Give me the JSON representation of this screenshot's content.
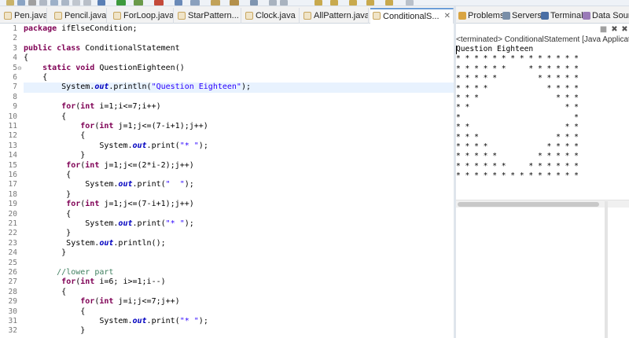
{
  "editor_tabs": [
    {
      "label": "Pen.java",
      "active": false
    },
    {
      "label": "Pencil.java",
      "active": false
    },
    {
      "label": "ForLoop.java",
      "active": false
    },
    {
      "label": "StarPattern...",
      "active": false
    },
    {
      "label": "Clock.java",
      "active": false
    },
    {
      "label": "AllPattern.java",
      "active": false
    },
    {
      "label": "ConditionalS...",
      "active": true
    }
  ],
  "active_tab_close": "✕",
  "line_numbers": [
    "1",
    "2",
    "3",
    "4",
    "5",
    "6",
    "7",
    "8",
    "9",
    "10",
    "11",
    "12",
    "13",
    "14",
    "15",
    "16",
    "17",
    "18",
    "19",
    "20",
    "21",
    "22",
    "23",
    "24",
    "25",
    "26",
    "27",
    "28",
    "29",
    "30",
    "31",
    "32"
  ],
  "fold_markers": {
    "line_5": "⊖"
  },
  "code_lines": [
    [
      {
        "t": "package",
        "c": "kw"
      },
      {
        "t": " ifElseCondition;",
        "c": ""
      }
    ],
    [],
    [
      {
        "t": "public",
        "c": "kw"
      },
      {
        "t": " ",
        "c": ""
      },
      {
        "t": "class",
        "c": "kw"
      },
      {
        "t": " ConditionalStatement",
        "c": ""
      }
    ],
    [
      {
        "t": "{",
        "c": ""
      }
    ],
    [
      {
        "t": "    ",
        "c": ""
      },
      {
        "t": "static",
        "c": "kw"
      },
      {
        "t": " ",
        "c": ""
      },
      {
        "t": "void",
        "c": "kw"
      },
      {
        "t": " QuestionEighteen()",
        "c": ""
      }
    ],
    [
      {
        "t": "    {",
        "c": ""
      }
    ],
    [
      {
        "t": "        System.",
        "c": ""
      },
      {
        "t": "out",
        "c": "fld"
      },
      {
        "t": ".println(",
        "c": ""
      },
      {
        "t": "\"Question Eighteen\"",
        "c": "str"
      },
      {
        "t": ");",
        "c": ""
      }
    ],
    [],
    [
      {
        "t": "        ",
        "c": ""
      },
      {
        "t": "for",
        "c": "kw"
      },
      {
        "t": "(",
        "c": ""
      },
      {
        "t": "int",
        "c": "kw"
      },
      {
        "t": " i=1;i<=7;i++)",
        "c": ""
      }
    ],
    [
      {
        "t": "        {",
        "c": ""
      }
    ],
    [
      {
        "t": "            ",
        "c": ""
      },
      {
        "t": "for",
        "c": "kw"
      },
      {
        "t": "(",
        "c": ""
      },
      {
        "t": "int",
        "c": "kw"
      },
      {
        "t": " j=1;j<=(7-i+1);j++)",
        "c": ""
      }
    ],
    [
      {
        "t": "            {",
        "c": ""
      }
    ],
    [
      {
        "t": "                System.",
        "c": ""
      },
      {
        "t": "out",
        "c": "fld"
      },
      {
        "t": ".print(",
        "c": ""
      },
      {
        "t": "\"* \"",
        "c": "str"
      },
      {
        "t": ");",
        "c": ""
      }
    ],
    [
      {
        "t": "            }",
        "c": ""
      }
    ],
    [
      {
        "t": "         ",
        "c": ""
      },
      {
        "t": "for",
        "c": "kw"
      },
      {
        "t": "(",
        "c": ""
      },
      {
        "t": "int",
        "c": "kw"
      },
      {
        "t": " j=1;j<=(2*i-2);j++)",
        "c": ""
      }
    ],
    [
      {
        "t": "         {",
        "c": ""
      }
    ],
    [
      {
        "t": "             System.",
        "c": ""
      },
      {
        "t": "out",
        "c": "fld"
      },
      {
        "t": ".print(",
        "c": ""
      },
      {
        "t": "\"  \"",
        "c": "str"
      },
      {
        "t": ");",
        "c": ""
      }
    ],
    [
      {
        "t": "         }",
        "c": ""
      }
    ],
    [
      {
        "t": "         ",
        "c": ""
      },
      {
        "t": "for",
        "c": "kw"
      },
      {
        "t": "(",
        "c": ""
      },
      {
        "t": "int",
        "c": "kw"
      },
      {
        "t": " j=1;j<=(7-i+1);j++)",
        "c": ""
      }
    ],
    [
      {
        "t": "         {",
        "c": ""
      }
    ],
    [
      {
        "t": "             System.",
        "c": ""
      },
      {
        "t": "out",
        "c": "fld"
      },
      {
        "t": ".print(",
        "c": ""
      },
      {
        "t": "\"* \"",
        "c": "str"
      },
      {
        "t": ");",
        "c": ""
      }
    ],
    [
      {
        "t": "         }",
        "c": ""
      }
    ],
    [
      {
        "t": "         System.",
        "c": ""
      },
      {
        "t": "out",
        "c": "fld"
      },
      {
        "t": ".println();",
        "c": ""
      }
    ],
    [
      {
        "t": "        }",
        "c": ""
      }
    ],
    [],
    [
      {
        "t": "       ",
        "c": ""
      },
      {
        "t": "//lower part",
        "c": "cmt"
      }
    ],
    [
      {
        "t": "        ",
        "c": ""
      },
      {
        "t": "for",
        "c": "kw"
      },
      {
        "t": "(",
        "c": ""
      },
      {
        "t": "int",
        "c": "kw"
      },
      {
        "t": " i=6; i>=1;i--)",
        "c": ""
      }
    ],
    [
      {
        "t": "        {",
        "c": ""
      }
    ],
    [
      {
        "t": "            ",
        "c": ""
      },
      {
        "t": "for",
        "c": "kw"
      },
      {
        "t": "(",
        "c": ""
      },
      {
        "t": "int",
        "c": "kw"
      },
      {
        "t": " j=i;j<=7;j++)",
        "c": ""
      }
    ],
    [
      {
        "t": "            {",
        "c": ""
      }
    ],
    [
      {
        "t": "                System.",
        "c": ""
      },
      {
        "t": "out",
        "c": "fld"
      },
      {
        "t": ".print(",
        "c": ""
      },
      {
        "t": "\"* \"",
        "c": "str"
      },
      {
        "t": ");",
        "c": ""
      }
    ],
    [
      {
        "t": "            }",
        "c": ""
      }
    ]
  ],
  "highlighted_line": 7,
  "view_tabs": [
    {
      "label": "Problems",
      "icon": "problems-icon",
      "color": "#d9a441"
    },
    {
      "label": "Servers",
      "icon": "servers-icon",
      "color": "#7a8fa8"
    },
    {
      "label": "Terminal",
      "icon": "terminal-icon",
      "color": "#4a6fa5"
    },
    {
      "label": "Data Sour...",
      "icon": "data-source-icon",
      "color": "#9a7bb8"
    }
  ],
  "console_buttons": {
    "stop": "■",
    "remove": "✖",
    "remove_all": "✖"
  },
  "console_status": "<terminated> ConditionalStatement [Java Application]",
  "console_output": [
    "Question Eighteen",
    "* * * * * * * * * * * * * *",
    "* * * * * *     * * * * * *",
    "* * * * *         * * * * *",
    "* * * *             * * * *",
    "* * *                 * * *",
    "* *                     * *",
    "*                         *",
    "* *                     * *",
    "* * *                 * * *",
    "* * * *             * * * *",
    "* * * * *         * * * * *",
    "* * * * * *     * * * * * *",
    "* * * * * * * * * * * * * *"
  ]
}
